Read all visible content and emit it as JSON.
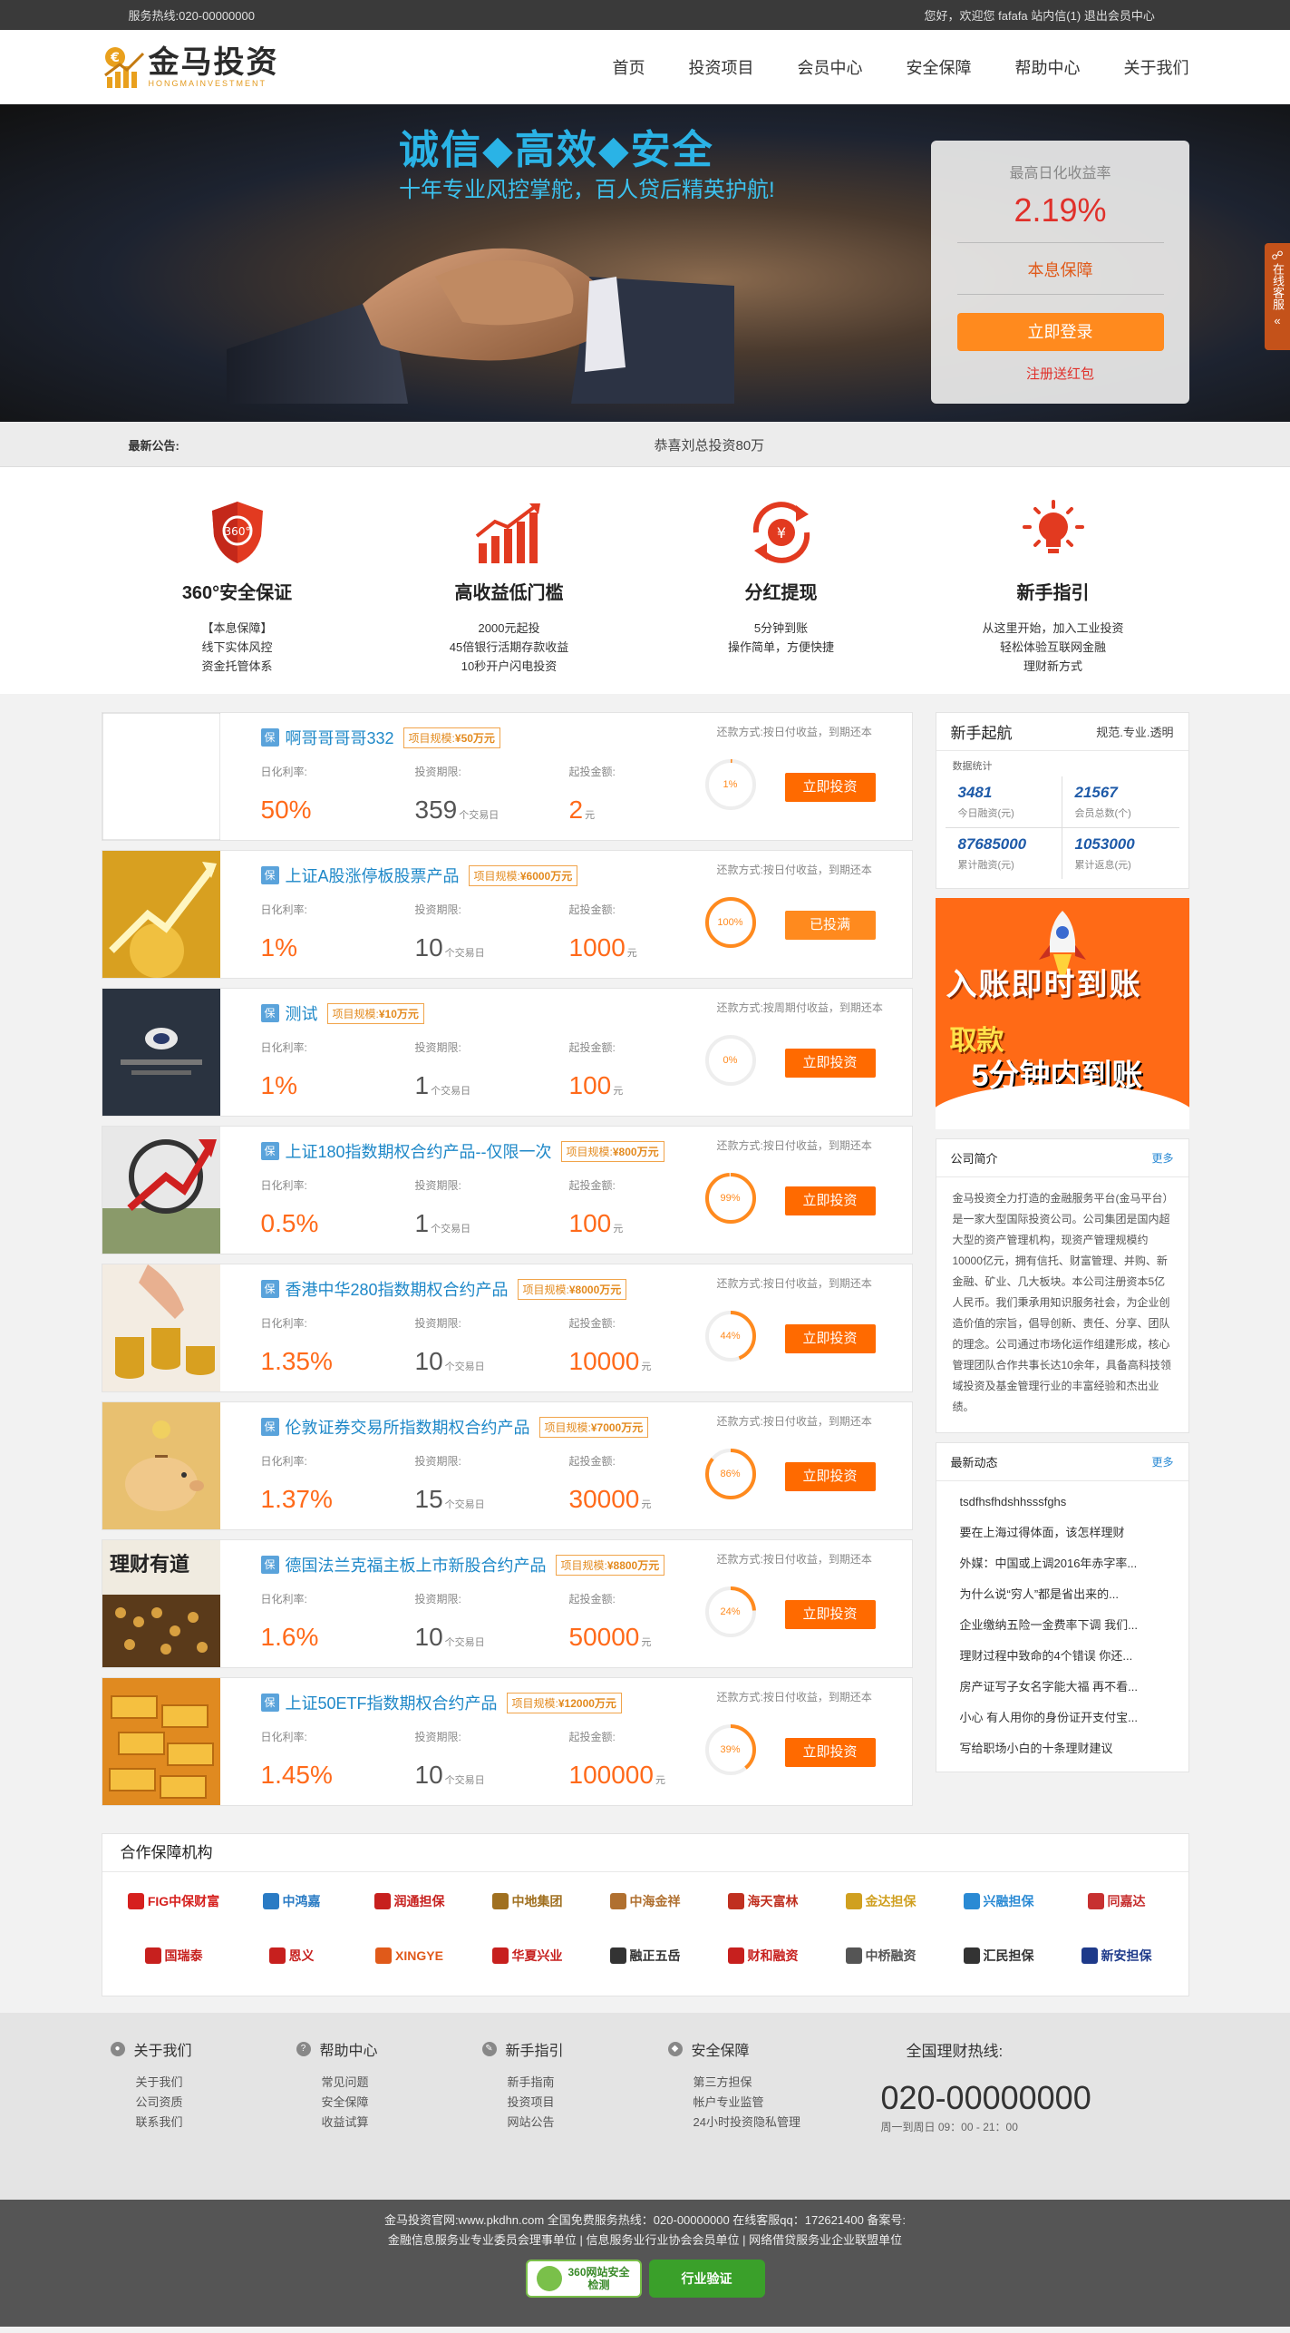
{
  "topbar": {
    "hotline": "服务热线:020-00000000",
    "greeting": "您好，欢迎您",
    "user": "fafafa",
    "messages": "站内信(1)",
    "logout": "退出会员中心"
  },
  "header": {
    "logo_cn": "金马投资",
    "logo_en": "HONGMAINVESTMENT",
    "nav": [
      "首页",
      "投资项目",
      "会员中心",
      "安全保障",
      "帮助中心",
      "关于我们"
    ]
  },
  "banner": {
    "slogan": "诚信◆高效◆安全",
    "sub": "十年专业风控掌舵，百人贷后精英护航!",
    "rate_label": "最高日化收益率",
    "rate": "2.19%",
    "guarantee": "本息保障",
    "login_btn": "立即登录",
    "register": "注册送红包"
  },
  "side_service": "在线客服",
  "notice": {
    "label": "最新公告:",
    "text": "恭喜刘总投资80万"
  },
  "features": [
    {
      "title": "360°安全保证",
      "desc": "【本息保障】\n线下实体风控\n资金托管体系",
      "icon": "shield-icon"
    },
    {
      "title": "高收益低门槛",
      "desc": "2000元起投\n45倍银行活期存款收益\n10秒开户闪电投资",
      "icon": "chart-growth-icon"
    },
    {
      "title": "分红提现",
      "desc": "5分钟到账\n操作简单，方便快捷",
      "icon": "yen-cycle-icon"
    },
    {
      "title": "新手指引",
      "desc": "从这里开始，加入工业投资\n轻松体验互联网金融\n理财新方式",
      "icon": "lightbulb-icon"
    }
  ],
  "product_labels": {
    "rate": "日化利率:",
    "period": "投资期限:",
    "min": "起投金额:",
    "unit_day": "个交易日",
    "unit_yuan": "元",
    "scale_prefix": "项目规模:",
    "repay_prefix": "还款方式:",
    "bao": "保"
  },
  "products": [
    {
      "title": "啊哥哥哥哥332",
      "scale": "¥50万元",
      "repay": "按日付收益，到期还本",
      "rate_pct": "50",
      "period": "359",
      "min": "2",
      "progress": "1%",
      "progress_value": 1,
      "button": "立即投资",
      "full": false,
      "img": "blank"
    },
    {
      "title": "上证A股涨停板股票产品",
      "scale": "¥6000万元",
      "repay": "按日付收益，到期还本",
      "rate_pct": "1",
      "period": "10",
      "min": "1000",
      "progress": "100%",
      "progress_value": 100,
      "button": "已投满",
      "full": true,
      "img": "gold"
    },
    {
      "title": "测试",
      "scale": "¥10万元",
      "repay": "按周期付收益，到期还本",
      "rate_pct": "1",
      "period": "1",
      "min": "100",
      "progress": "0%",
      "progress_value": 0,
      "button": "立即投资",
      "full": false,
      "img": "dark"
    },
    {
      "title": "上证180指数期权合约产品--仅限一次",
      "scale": "¥800万元",
      "repay": "按日付收益，到期还本",
      "rate_pct": "0.5",
      "period": "1",
      "min": "100",
      "progress": "99%",
      "progress_value": 99,
      "button": "立即投资",
      "full": false,
      "img": "arrow"
    },
    {
      "title": "香港中华280指数期权合约产品",
      "scale": "¥8000万元",
      "repay": "按日付收益，到期还本",
      "rate_pct": "1.35",
      "period": "10",
      "min": "10000",
      "progress": "44%",
      "progress_value": 44,
      "button": "立即投资",
      "full": false,
      "img": "coins"
    },
    {
      "title": "伦敦证券交易所指数期权合约产品",
      "scale": "¥7000万元",
      "repay": "按日付收益，到期还本",
      "rate_pct": "1.37",
      "period": "15",
      "min": "30000",
      "progress": "86%",
      "progress_value": 86,
      "button": "立即投资",
      "full": false,
      "img": "piggy"
    },
    {
      "title": "德国法兰克福主板上市新股合约产品",
      "scale": "¥8800万元",
      "repay": "按日付收益，到期还本",
      "rate_pct": "1.6",
      "period": "10",
      "min": "50000",
      "progress": "24%",
      "progress_value": 24,
      "button": "立即投资",
      "full": false,
      "img": "abacus"
    },
    {
      "title": "上证50ETF指数期权合约产品",
      "scale": "¥12000万元",
      "repay": "按日付收益，到期还本",
      "rate_pct": "1.45",
      "period": "10",
      "min": "100000",
      "progress": "39%",
      "progress_value": 39,
      "button": "立即投资",
      "full": false,
      "img": "bars"
    }
  ],
  "sidebar": {
    "guide_title": "新手起航",
    "guide_sub": "规范.专业.透明",
    "stats_caption": "数据统计",
    "stats": [
      {
        "value": "3481",
        "label": "今日融资(元)"
      },
      {
        "value": "21567",
        "label": "会员总数(个)"
      },
      {
        "value": "87685000",
        "label": "累计融资(元)"
      },
      {
        "value": "1053000",
        "label": "累计返息(元)"
      }
    ],
    "promo": {
      "line1": "入账即时到账",
      "line2": "取款",
      "line3": "5分钟内到账"
    },
    "intro_title": "公司简介",
    "more": "更多",
    "intro_text": "金马投资全力打造的金融服务平台(金马平台）是一家大型国际投资公司。公司集团是国内超大型的资产管理机构，现资产管理规模约10000亿元，拥有信托、财富管理、并购、新金融、矿业、几大板块。本公司注册资本5亿人民币。我们秉承用知识服务社会，为企业创造价值的宗旨，倡导创新、责任、分享、团队的理念。公司通过市场化运作组建形成，核心管理团队合作共事长达10余年，具备高科技领域投资及基金管理行业的丰富经验和杰出业绩。",
    "news_title": "最新动态",
    "news": [
      "tsdfhsfhdshhsssfghs",
      "要在上海过得体面，该怎样理财",
      "外媒：中国或上调2016年赤字率...",
      "为什么说“穷人”都是省出来的...",
      "企业缴纳五险一金费率下调 我们...",
      "理财过程中致命的4个错误 你还...",
      "房产证写子女名字能大福 再不看...",
      "小心 有人用你的身份证开支付宝...",
      "写给职场小白的十条理财建议"
    ]
  },
  "partners": {
    "title": "合作保障机构",
    "logos": [
      {
        "name": "FIG中保财富",
        "color": "#d6201e"
      },
      {
        "name": "中鸿嘉",
        "color": "#2a7bc4"
      },
      {
        "name": "润通担保",
        "color": "#c7201e"
      },
      {
        "name": "中地集团",
        "color": "#a07020"
      },
      {
        "name": "中海金祥",
        "color": "#b07030"
      },
      {
        "name": "海天富林",
        "color": "#c03020"
      },
      {
        "name": "金达担保",
        "color": "#d0a020"
      },
      {
        "name": "兴融担保",
        "color": "#2a8ad4"
      },
      {
        "name": "同嘉达",
        "color": "#c73030"
      },
      {
        "name": "国瑞泰",
        "color": "#c7201e"
      },
      {
        "name": "恩义",
        "color": "#c7201e"
      },
      {
        "name": "XINGYE",
        "color": "#e05a1a"
      },
      {
        "name": "华夏兴业",
        "color": "#c7201e"
      },
      {
        "name": "融正五岳",
        "color": "#333333"
      },
      {
        "name": "财和融资",
        "color": "#c7201e"
      },
      {
        "name": "中桥融资",
        "color": "#555555"
      },
      {
        "name": "汇民担保",
        "color": "#333333"
      },
      {
        "name": "新安担保",
        "color": "#1e3a8a"
      }
    ]
  },
  "footer": {
    "cols": [
      {
        "title": "关于我们",
        "links": [
          "关于我们",
          "公司资质",
          "联系我们"
        ]
      },
      {
        "title": "帮助中心",
        "links": [
          "常见问题",
          "安全保障",
          "收益试算"
        ]
      },
      {
        "title": "新手指引",
        "links": [
          "新手指南",
          "投资项目",
          "网站公告"
        ]
      },
      {
        "title": "安全保障",
        "links": [
          "第三方担保",
          "帐户专业监管",
          "24小时投资隐私管理"
        ]
      }
    ],
    "hotline_label": "全国理财热线:",
    "hotline": "020-00000000",
    "hours": "周一到周日 09：00 - 21：00",
    "line1": "金马投资官网:www.pkdhn.com 全国免费服务热线：020-00000000 在线客服qq：172621400 备案号:",
    "line2": "金融信息服务业专业委员会理事单位 | 信息服务业行业协会会员单位 | 网络借贷服务业企业联盟单位",
    "badge1": "360网站安全检测",
    "badge2": "行业验证"
  },
  "colors": {
    "accent": "#ff6a00",
    "link": "#1e88c8",
    "banner_text": "#2ab3e6"
  }
}
